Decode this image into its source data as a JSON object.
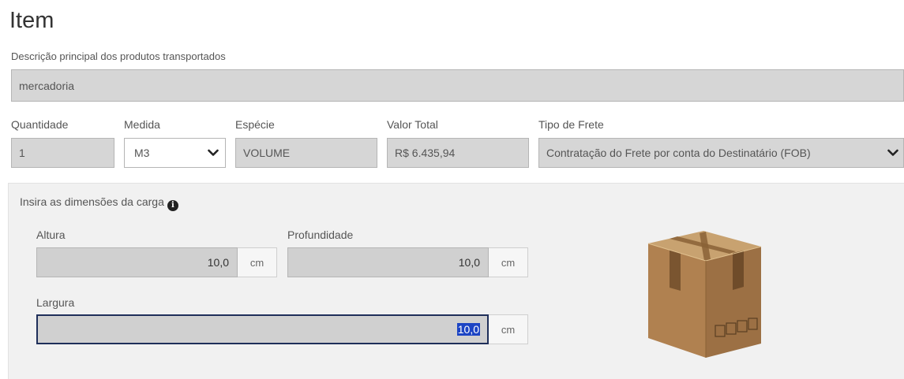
{
  "section_title": "Item",
  "description": {
    "label": "Descrição principal dos produtos transportados",
    "value": "mercadoria"
  },
  "quantidade": {
    "label": "Quantidade",
    "value": "1"
  },
  "medida": {
    "label": "Medida",
    "value": "M3"
  },
  "especie": {
    "label": "Espécie",
    "value": "VOLUME"
  },
  "valor_total": {
    "label": "Valor Total",
    "value": "R$ 6.435,94"
  },
  "tipo_frete": {
    "label": "Tipo de Frete",
    "value": "Contratação do Frete por conta do Destinatário (FOB)"
  },
  "dimensions": {
    "heading": "Insira as dimensões da carga",
    "altura": {
      "label": "Altura",
      "value": "10,0",
      "unit": "cm"
    },
    "profundidade": {
      "label": "Profundidade",
      "value": "10,0",
      "unit": "cm"
    },
    "largura": {
      "label": "Largura",
      "value": "10,0",
      "unit": "cm"
    }
  },
  "icons": [
    "chevron-down-icon",
    "info-icon",
    "box-illustration"
  ],
  "colors": {
    "input_bg": "#d6d6d6",
    "panel_bg": "#f1f1f1",
    "focus_border": "#1f2f5a",
    "selection": "#1c44c4"
  }
}
